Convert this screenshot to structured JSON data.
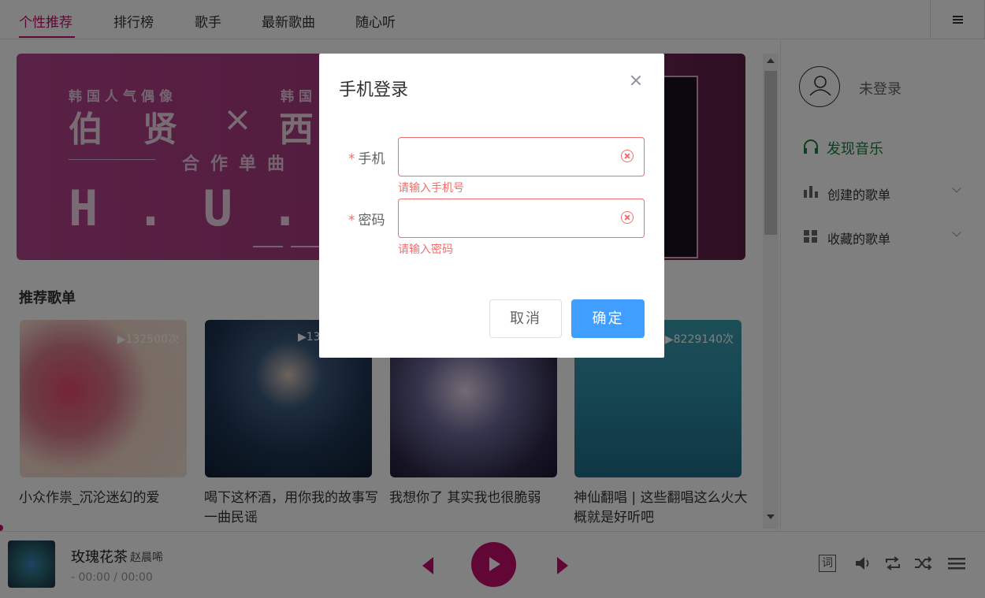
{
  "nav": {
    "tabs": [
      {
        "label": "个性推荐",
        "active": true
      },
      {
        "label": "排行榜"
      },
      {
        "label": "歌手"
      },
      {
        "label": "最新歌曲"
      },
      {
        "label": "随心听"
      }
    ],
    "menu_icon": "hamburger-icon"
  },
  "banner": {
    "line1_left": "韩国人气偶像",
    "line1_right": "韩国",
    "headline_left": "伯贤",
    "headline_cross": "×",
    "headline_right": "西",
    "subline": "合作单曲",
    "big_text": "H.U.R"
  },
  "playlists": {
    "title": "推荐歌单",
    "items": [
      {
        "name": "小众作祟_沉沦迷幻的爱",
        "plays": "▶132500次"
      },
      {
        "name": "喝下这杯酒，用你我的故事写一曲民谣",
        "plays": "▶13"
      },
      {
        "name": "我想你了 其实我也很脆弱",
        "plays": ""
      },
      {
        "name": "神仙翻唱 | 这些翻唱这么火大概就是好听吧",
        "plays": "▶8229140次"
      }
    ]
  },
  "sidebar": {
    "login_label": "未登录",
    "discover": "发现音乐",
    "created": "创建的歌单",
    "collected": "收藏的歌单"
  },
  "player": {
    "song": "玫瑰花茶",
    "artist": "赵晨唏",
    "time": "- 00:00 / 00:00",
    "lyric_button": "词",
    "accent": "#c20c6a"
  },
  "dialog": {
    "title": "手机登录",
    "phone_label": "手机",
    "phone_value": "",
    "phone_error": "请输入手机号",
    "password_label": "密码",
    "password_value": "",
    "password_error": "请输入密码",
    "required_mark": "*",
    "cancel": "取消",
    "confirm": "确定",
    "error_color": "#f56c6c",
    "primary_color": "#409eff"
  }
}
